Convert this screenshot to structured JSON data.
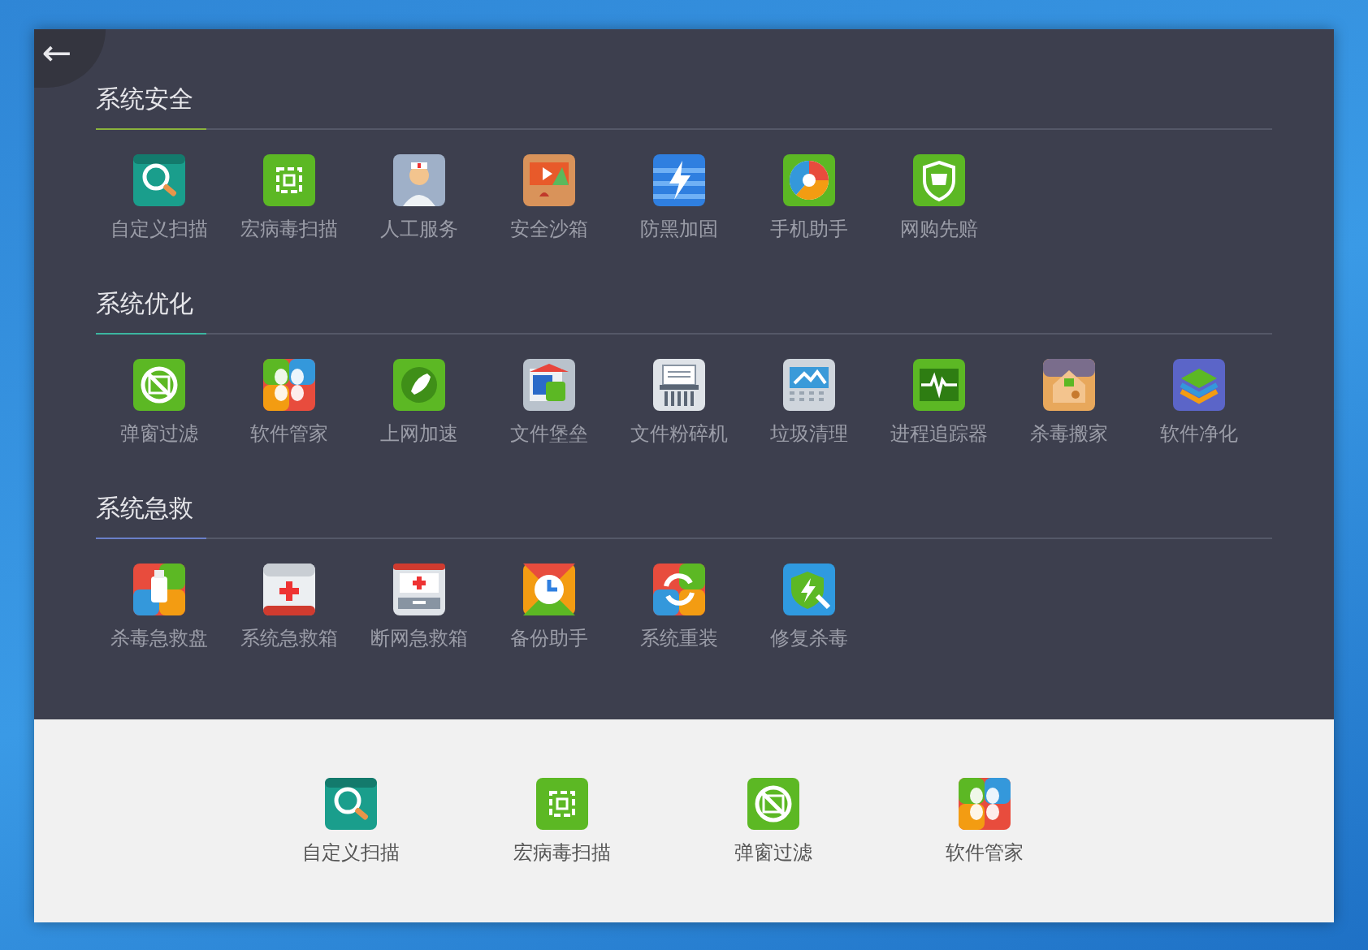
{
  "back_button": {
    "label": "←"
  },
  "sections": [
    {
      "title": "系统安全",
      "color": "#8ab23c",
      "items": [
        {
          "label": "自定义扫描"
        },
        {
          "label": "宏病毒扫描"
        },
        {
          "label": "人工服务"
        },
        {
          "label": "安全沙箱"
        },
        {
          "label": "防黑加固"
        },
        {
          "label": "手机助手"
        },
        {
          "label": "网购先赔"
        }
      ]
    },
    {
      "title": "系统优化",
      "color": "#3cb5a0",
      "items": [
        {
          "label": "弹窗过滤"
        },
        {
          "label": "软件管家"
        },
        {
          "label": "上网加速"
        },
        {
          "label": "文件堡垒"
        },
        {
          "label": "文件粉碎机"
        },
        {
          "label": "垃圾清理"
        },
        {
          "label": "进程追踪器"
        },
        {
          "label": "杀毒搬家"
        },
        {
          "label": "软件净化"
        }
      ]
    },
    {
      "title": "系统急救",
      "color": "#6a7fc8",
      "items": [
        {
          "label": "杀毒急救盘"
        },
        {
          "label": "系统急救箱"
        },
        {
          "label": "断网急救箱"
        },
        {
          "label": "备份助手"
        },
        {
          "label": "系统重装"
        },
        {
          "label": "修复杀毒"
        }
      ]
    }
  ],
  "dock": [
    {
      "label": "自定义扫描"
    },
    {
      "label": "宏病毒扫描"
    },
    {
      "label": "弹窗过滤"
    },
    {
      "label": "软件管家"
    }
  ]
}
